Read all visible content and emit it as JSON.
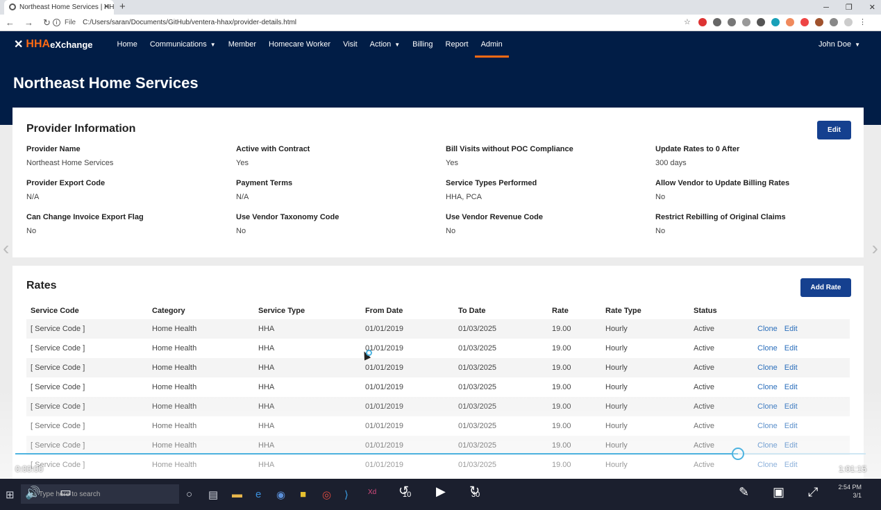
{
  "browser": {
    "tab_title": "Northeast Home Services | HHAe",
    "address_prefix": "File",
    "address": "C:/Users/saran/Documents/GitHub/ventera-hhax/provider-details.html"
  },
  "app": {
    "logo_hha": "HHA",
    "logo_ex": "eXchange",
    "nav": [
      {
        "label": "Home",
        "dropdown": false
      },
      {
        "label": "Communications",
        "dropdown": true
      },
      {
        "label": "Member",
        "dropdown": false
      },
      {
        "label": "Homecare Worker",
        "dropdown": false
      },
      {
        "label": "Visit",
        "dropdown": false
      },
      {
        "label": "Action",
        "dropdown": true
      },
      {
        "label": "Billing",
        "dropdown": false
      },
      {
        "label": "Report",
        "dropdown": false
      },
      {
        "label": "Admin",
        "dropdown": false,
        "active": true
      }
    ],
    "user": "John Doe"
  },
  "page": {
    "title": "Northeast Home Services"
  },
  "provider_info": {
    "title": "Provider Information",
    "edit_label": "Edit",
    "fields": [
      {
        "label": "Provider Name",
        "value": "Northeast Home Services"
      },
      {
        "label": "Active with Contract",
        "value": "Yes"
      },
      {
        "label": "Bill Visits without POC Compliance",
        "value": "Yes"
      },
      {
        "label": "Update Rates to 0 After",
        "value": "300 days"
      },
      {
        "label": "Provider Export Code",
        "value": "N/A"
      },
      {
        "label": "Payment Terms",
        "value": "N/A"
      },
      {
        "label": "Service Types Performed",
        "value": "HHA, PCA"
      },
      {
        "label": "Allow Vendor to Update Billing Rates",
        "value": "No"
      },
      {
        "label": "Can Change Invoice Export Flag",
        "value": "No"
      },
      {
        "label": "Use Vendor Taxonomy Code",
        "value": "No"
      },
      {
        "label": "Use Vendor Revenue Code",
        "value": "No"
      },
      {
        "label": "Restrict Rebilling of Original Claims",
        "value": "No"
      }
    ]
  },
  "rates": {
    "title": "Rates",
    "add_label": "Add Rate",
    "columns": [
      "Service Code",
      "Category",
      "Service Type",
      "From Date",
      "To Date",
      "Rate",
      "Rate Type",
      "Status"
    ],
    "clone_label": "Clone",
    "edit_label": "Edit",
    "rows": [
      [
        "[ Service Code ]",
        "Home Health",
        "HHA",
        "01/01/2019",
        "01/03/2025",
        "19.00",
        "Hourly",
        "Active"
      ],
      [
        "[ Service Code ]",
        "Home Health",
        "HHA",
        "01/01/2019",
        "01/03/2025",
        "19.00",
        "Hourly",
        "Active"
      ],
      [
        "[ Service Code ]",
        "Home Health",
        "HHA",
        "01/01/2019",
        "01/03/2025",
        "19.00",
        "Hourly",
        "Active"
      ],
      [
        "[ Service Code ]",
        "Home Health",
        "HHA",
        "01/01/2019",
        "01/03/2025",
        "19.00",
        "Hourly",
        "Active"
      ],
      [
        "[ Service Code ]",
        "Home Health",
        "HHA",
        "01/01/2019",
        "01/03/2025",
        "19.00",
        "Hourly",
        "Active"
      ],
      [
        "[ Service Code ]",
        "Home Health",
        "HHA",
        "01/01/2019",
        "01/03/2025",
        "19.00",
        "Hourly",
        "Active"
      ],
      [
        "[ Service Code ]",
        "Home Health",
        "HHA",
        "01/01/2019",
        "01/03/2025",
        "19.00",
        "Hourly",
        "Active"
      ],
      [
        "[ Service Code ]",
        "Home Health",
        "HHA",
        "01/01/2019",
        "01/03/2025",
        "19.00",
        "Hourly",
        "Active"
      ]
    ]
  },
  "video": {
    "elapsed": "0:00:00",
    "duration": "1:01:15",
    "progress": 0.85,
    "skip_back": "10",
    "skip_forward": "30"
  },
  "taskbar": {
    "search_placeholder": "Type here to search",
    "time": "2:54 PM",
    "date": "3/1"
  },
  "colors": {
    "navy": "#011d46",
    "accent": "#ff6a13",
    "button": "#15408f",
    "link": "#2a6ebb"
  }
}
